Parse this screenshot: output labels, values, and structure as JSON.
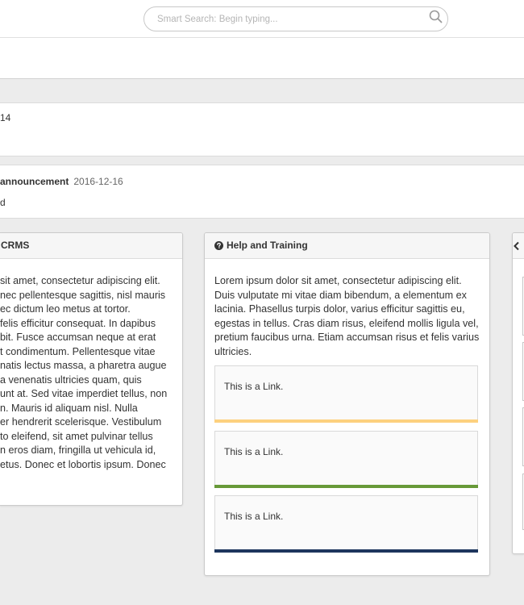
{
  "header": {
    "search": {
      "placeholder": "Smart Search: Begin typing...",
      "icon": "search-icon"
    }
  },
  "feed": {
    "item_1": {
      "text": "14"
    },
    "item_2": {
      "title": "announcement",
      "date": "2016-12-16",
      "text": "d"
    }
  },
  "cards": {
    "left": {
      "title": "CRMS",
      "body_lines": [
        "sit amet, consectetur adipiscing elit.",
        "nec pellentesque sagittis, nisl mauris",
        "ec dictum leo metus at tortor.",
        "felis efficitur consequat. In dapibus",
        "bit. Fusce accumsan neque at erat",
        "t condimentum. Pellentesque vitae",
        "natis lectus massa, a pharetra augue",
        "a venenatis ultricies quam, quis",
        "unt at. Sed vitae imperdiet tellus, non",
        "n. Mauris id aliquam nisl. Nulla",
        "er hendrerit scelerisque. Vestibulum",
        "to eleifend, sit amet pulvinar tellus",
        "n eros diam, fringilla ut vehicula id,",
        "etus. Donec et lobortis ipsum. Donec"
      ]
    },
    "help": {
      "title": "Help and Training",
      "icon": "question-circle-icon",
      "body_lines": [
        "Lorem ipsum dolor sit amet, consectetur adipiscing elit.",
        "Duis vulputate mi vitae diam bibendum, a elementum ex",
        "lacinia. Phasellus turpis dolor, varius efficitur sagittis eu,",
        "egestas in tellus. Cras diam risus, eleifend mollis ligula vel,",
        "pretium faucibus urna. Etiam accumsan risus et felis varius",
        "ultricies."
      ],
      "links": [
        {
          "label": "This is a Link.",
          "color": "#fdd17f"
        },
        {
          "label": "This is a Link.",
          "color": "#679938"
        },
        {
          "label": "This is a Link.",
          "color": "#1d355d"
        }
      ]
    },
    "right": {
      "icon": "partial-header-icon"
    }
  }
}
